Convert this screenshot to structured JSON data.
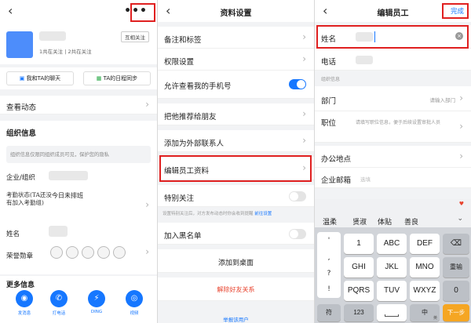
{
  "panel1": {
    "more_icon": "more-dots-icon",
    "contact_status": "1共在关注 | 2共在关注",
    "follow_button": "互相关注",
    "action1": "我和TA的聊天",
    "action2": "TA的日程同步",
    "dynamics": "查看动态",
    "section_title": "组织信息",
    "hint_text": "组织信息仅限同组织成员可见，保护您的隐私",
    "company_label": "企业/组织",
    "attendance_label": "考勤状态(TA还没有加入考勤组)",
    "attendance_value": "今日未排班",
    "name_label": "姓名",
    "honor_label": "荣誉勋章",
    "more_info": "更多信息",
    "bottom_actions": [
      "发消息",
      "打电话",
      "DING",
      "视频"
    ]
  },
  "panel2": {
    "title": "资料设置",
    "rows": [
      "备注和标签",
      "权限设置",
      "允许查看我的手机号",
      "把他推荐给朋友",
      "添加为外部联系人",
      "编辑员工资料",
      "特别关注"
    ],
    "tip": "设置特别关注后，对方发布动态时你会收到提醒",
    "tip_link": "前往设置",
    "blacklist": "加入黑名单",
    "add_desktop": "添加到桌面",
    "remove_friend": "解除好友关系",
    "report": "举报该用户"
  },
  "panel3": {
    "title": "编辑员工",
    "done": "完成",
    "name_label": "姓名",
    "phone_label": "电话",
    "section": "组织信息",
    "dept_label": "部门",
    "dept_value": "请输入部门",
    "position_label": "职位",
    "position_hint": "请填写职位信息，便于后续设置审批人员",
    "office_label": "办公地点",
    "email_label": "企业邮箱",
    "email_hint": "选填",
    "suggestions": [
      "温柔",
      "贤淑",
      "体贴",
      "善良"
    ],
    "keys_row1": [
      "'",
      "1",
      "ABC",
      "DEF"
    ],
    "keys_row2": [
      ",",
      "GHI",
      "JKL",
      "MNO",
      "重输"
    ],
    "keys_row3": [
      "?",
      "PQRS",
      "TUV",
      "WXYZ",
      "0"
    ],
    "keys_row4": [
      "符",
      "123",
      "中",
      "下一步"
    ],
    "symbol_col": [
      "'",
      ",",
      "?",
      "!"
    ],
    "delete_icon": "backspace-icon",
    "space_sub": "英",
    "next_color": "#f5a623"
  },
  "colors": {
    "accent": "#1677ff",
    "danger": "#e8432e",
    "highlight": "#e02020"
  }
}
